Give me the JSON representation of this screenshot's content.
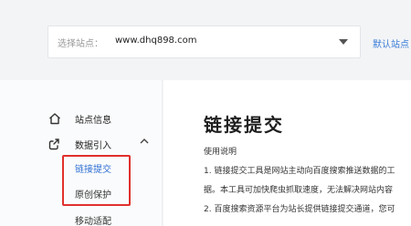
{
  "header": {
    "site_label": "选择站点：",
    "site_value": "www.dhq898.com",
    "default_site_link": "默认站点"
  },
  "sidebar": {
    "items": [
      {
        "label": "站点信息",
        "icon": "home-icon"
      },
      {
        "label": "数据引入",
        "icon": "data-import-icon",
        "expanded": true
      }
    ],
    "sub_items": [
      {
        "label": "链接提交",
        "active": true
      },
      {
        "label": "原创保护",
        "active": false
      },
      {
        "label": "移动适配",
        "active": false
      }
    ]
  },
  "main": {
    "title": "链接提交",
    "lines": [
      "使用说明",
      "1. 链接提交工具是网站主动向百度搜索推送数据的工",
      "据。本工具可加快爬虫抓取速度，无法解决网站内容",
      "2. 百度搜索资源平台为站长提供链接提交通道，您可"
    ]
  },
  "colors": {
    "accent": "#2e6fd3",
    "highlight": "#e0302c",
    "background": "#f3f4f6"
  }
}
